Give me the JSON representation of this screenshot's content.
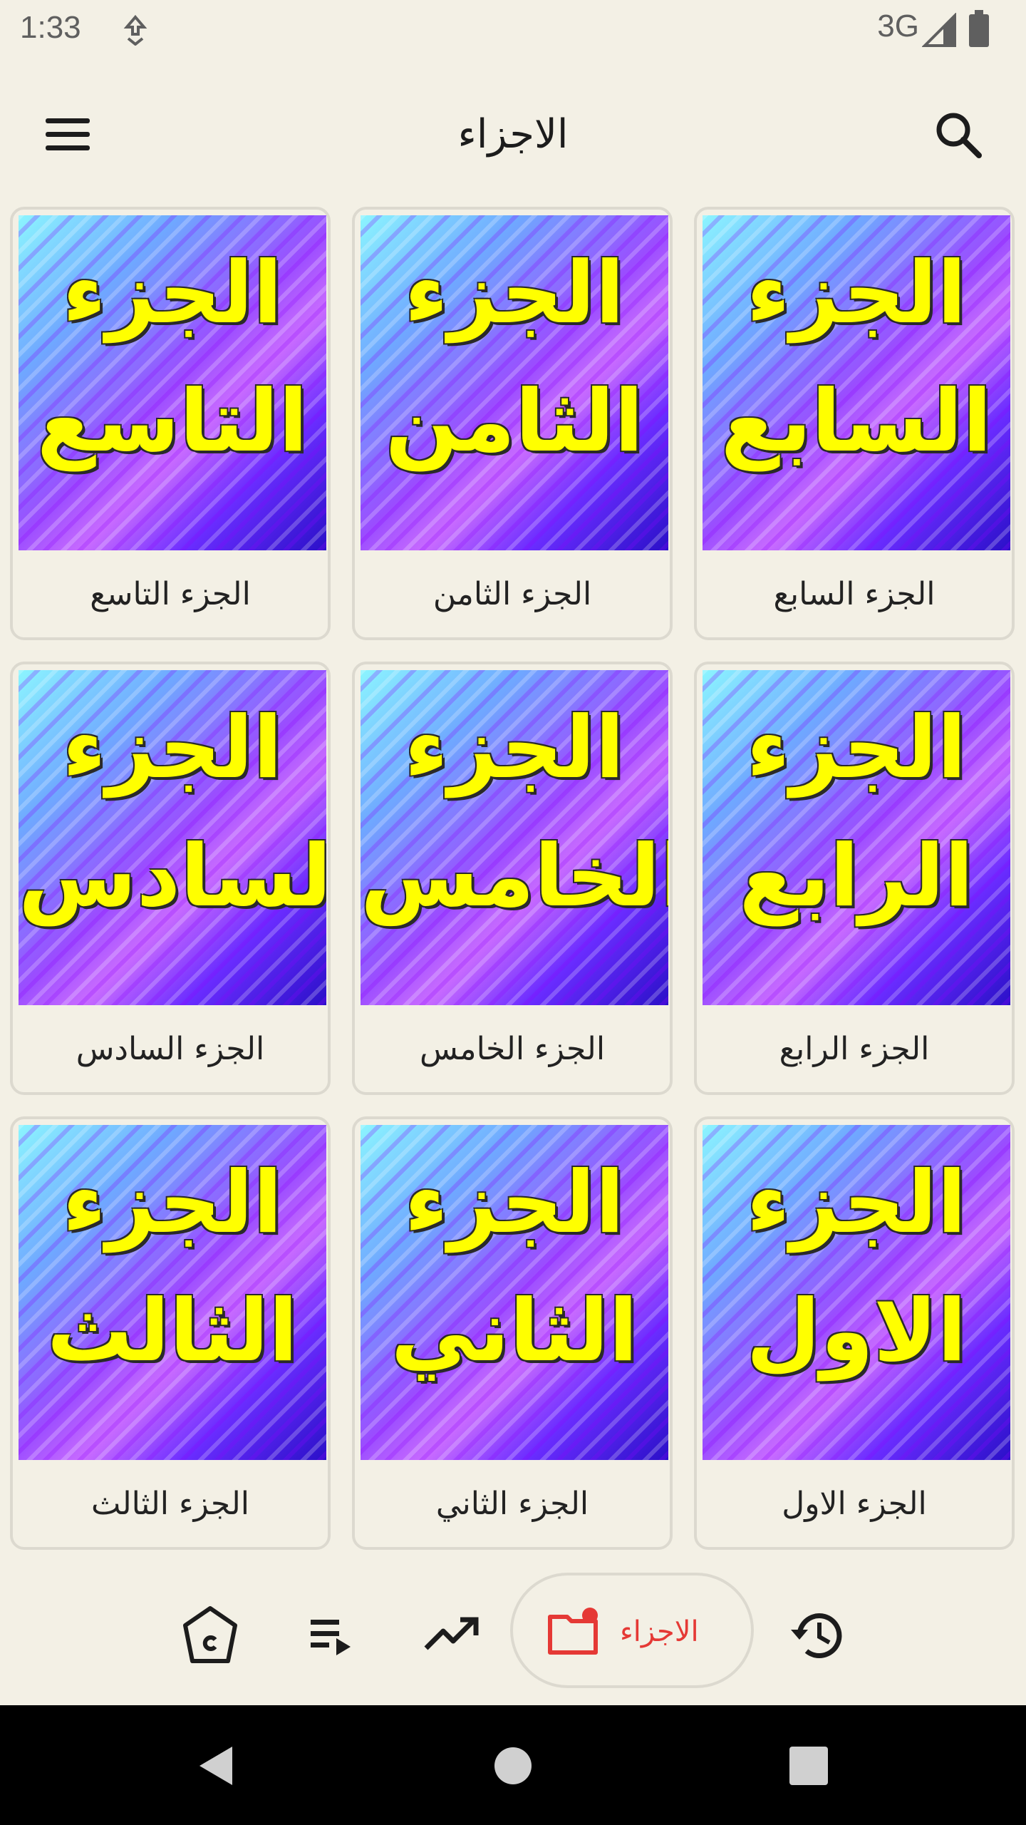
{
  "status_bar": {
    "time": "1:33",
    "network": "3G"
  },
  "app_bar": {
    "title": "الاجزاء"
  },
  "thumbs": [
    {
      "line1": "الجزء",
      "line2": "التاسع"
    },
    {
      "line1": "الجزء",
      "line2": "الثامن"
    },
    {
      "line1": "الجزء",
      "line2": "السابع"
    },
    {
      "line1": "الجزء",
      "line2": "السادس"
    },
    {
      "line1": "الجزء",
      "line2": "الخامس"
    },
    {
      "line1": "الجزء",
      "line2": "الرابع"
    },
    {
      "line1": "الجزء",
      "line2": "الثالث"
    },
    {
      "line1": "الجزء",
      "line2": "الثاني"
    },
    {
      "line1": "الجزء",
      "line2": "الاول"
    }
  ],
  "cards": [
    {
      "label": "الجزء التاسع"
    },
    {
      "label": "الجزء الثامن"
    },
    {
      "label": "الجزء السابع"
    },
    {
      "label": "الجزء السادس"
    },
    {
      "label": "الجزء الخامس"
    },
    {
      "label": "الجزء الرابع"
    },
    {
      "label": "الجزء الثالث"
    },
    {
      "label": "الجزء الثاني"
    },
    {
      "label": "الجزء الاول"
    }
  ],
  "bottom_nav": {
    "items": [
      {
        "icon": "home-icon"
      },
      {
        "icon": "playlist-icon"
      },
      {
        "icon": "trending-icon"
      },
      {
        "icon": "folder-icon",
        "label": "الاجزاء",
        "active": true
      },
      {
        "icon": "history-icon"
      }
    ]
  },
  "colors": {
    "accent": "#e53935",
    "background": "#f3f0e5",
    "thumb_text": "#ffff00"
  }
}
